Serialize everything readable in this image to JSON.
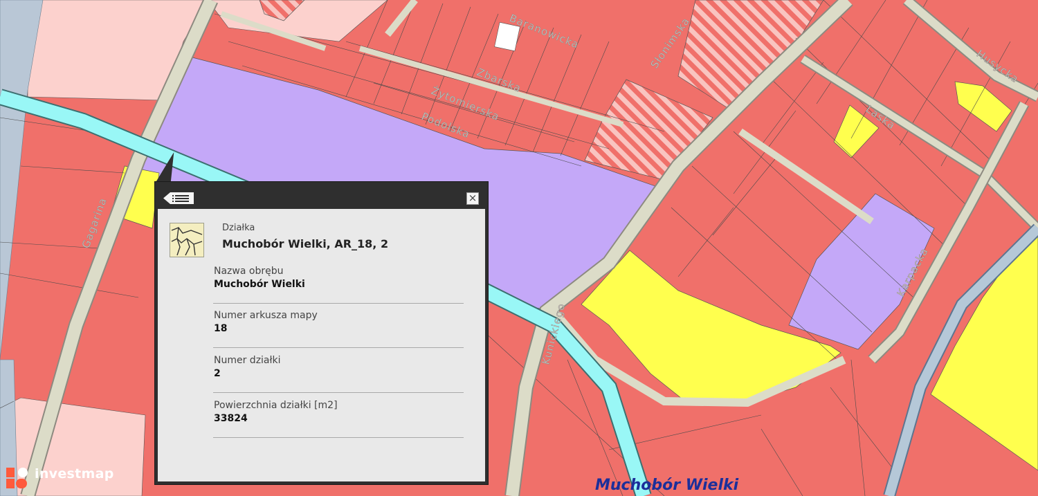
{
  "map": {
    "streets": {
      "gagarina": "Gagarina",
      "baranowicka": "Baranowicka",
      "zbarska": "Zbarska",
      "zytomierska": "Żytomierska",
      "podolska": "Podolska",
      "slonimska": "Słonimska",
      "husycka": "Husycka",
      "laska": "Laska",
      "karpacka": "Karpacka",
      "kunickiego": "Kunickiego"
    },
    "district_label": "Muchobór Wielki",
    "colors": {
      "residential": "#f0706a",
      "residential_light": "#fcd1cd",
      "services": "#c4a8f8",
      "green": "#ffff4e",
      "water": "#99f7f6",
      "road": "#dcdcc8",
      "rail": "#b5c8d8"
    }
  },
  "popup": {
    "menu_icon": "list-icon",
    "close_icon": "close-icon",
    "layer_name": "Działka",
    "title": "Muchobór Wielki, AR_18, 2",
    "fields": [
      {
        "label": "Nazwa obrębu",
        "value": "Muchobór Wielki"
      },
      {
        "label": "Numer arkusza mapy",
        "value": "18"
      },
      {
        "label": "Numer działki",
        "value": "2"
      },
      {
        "label": "Powierzchnia działki [m2]",
        "value": "33824"
      }
    ]
  },
  "branding": {
    "logo_text": "investmap",
    "logo_color": "#ff5a3c"
  }
}
